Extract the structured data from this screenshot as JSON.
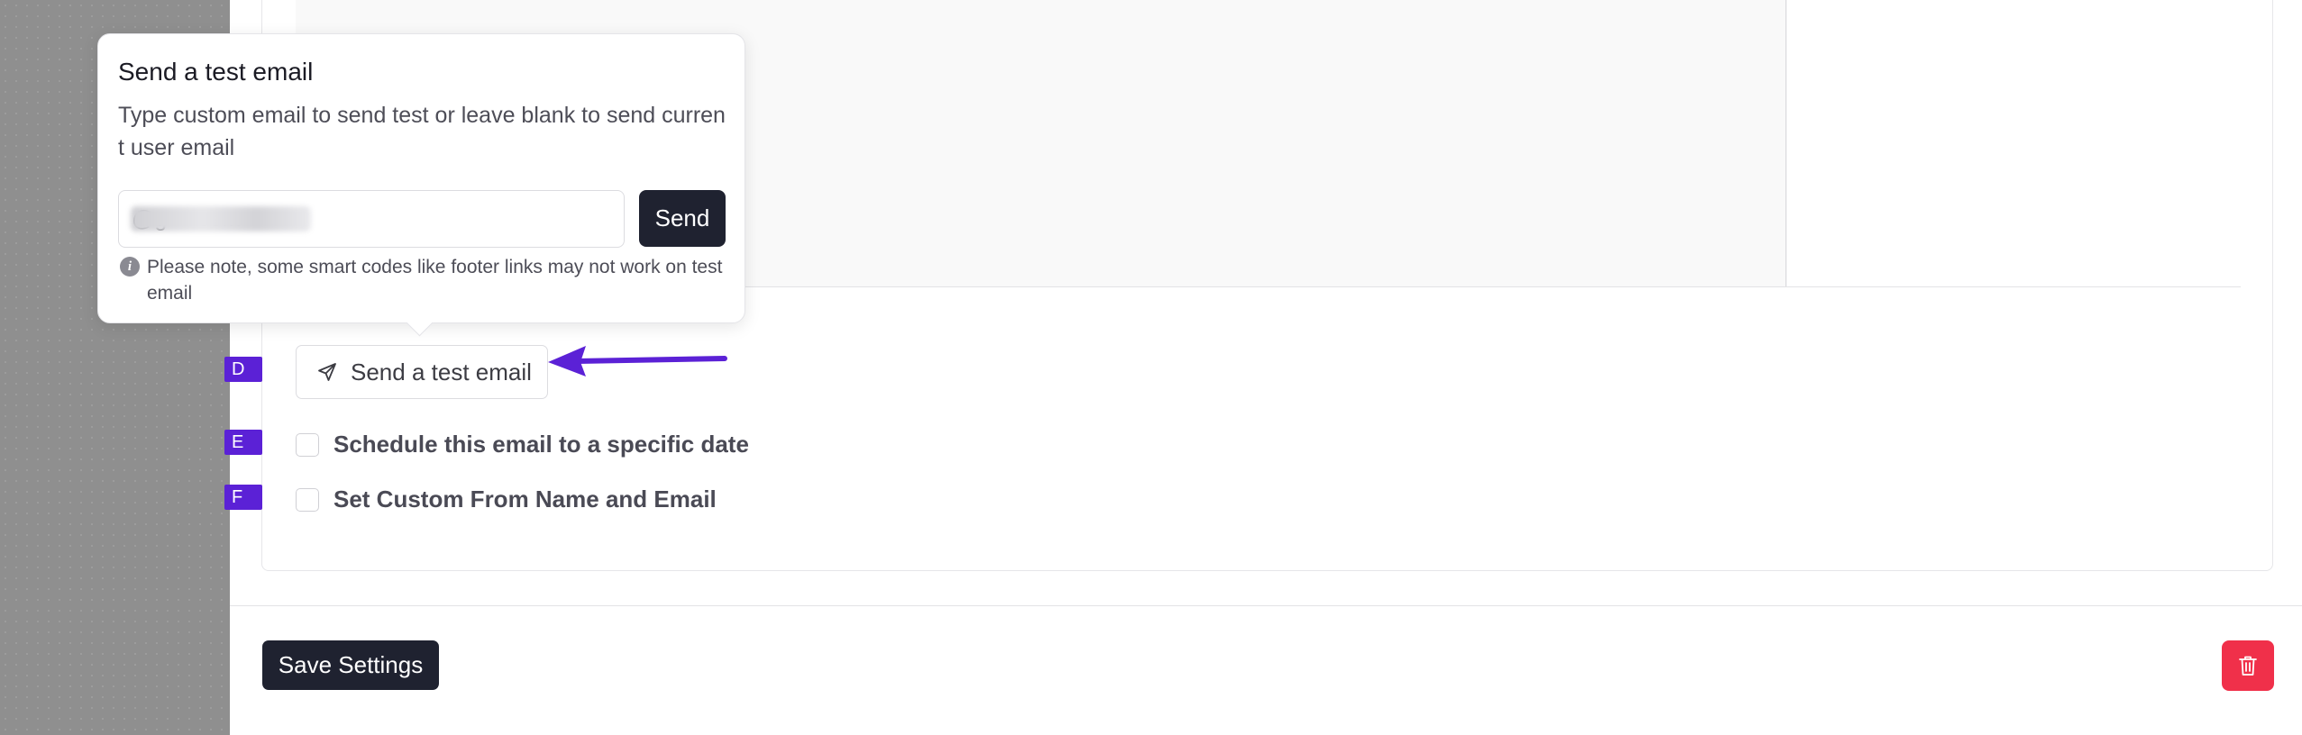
{
  "popover": {
    "title": "Send a test email",
    "description": "Type custom email to send test or leave blank to send current user email",
    "email_value": "@g     com",
    "send_label": "Send",
    "note": "Please note, some smart codes like footer links may not work on test email",
    "note_icon": "info-icon"
  },
  "steps": {
    "d": "D",
    "e": "E",
    "f": "F"
  },
  "test_button": {
    "label": "Send a test email",
    "icon": "paper-plane-icon"
  },
  "options": {
    "schedule_label": "Schedule this email to a specific date",
    "schedule_checked": false,
    "custom_from_label": "Set Custom From Name and Email",
    "custom_from_checked": false
  },
  "footer": {
    "save_label": "Save Settings",
    "delete_icon": "trash-icon"
  },
  "colors": {
    "badge": "#5b21d6",
    "arrow": "#5b21d6",
    "primary_button": "#1f2230",
    "danger_button": "#f0304a",
    "gutter": "#8f8f8f"
  }
}
